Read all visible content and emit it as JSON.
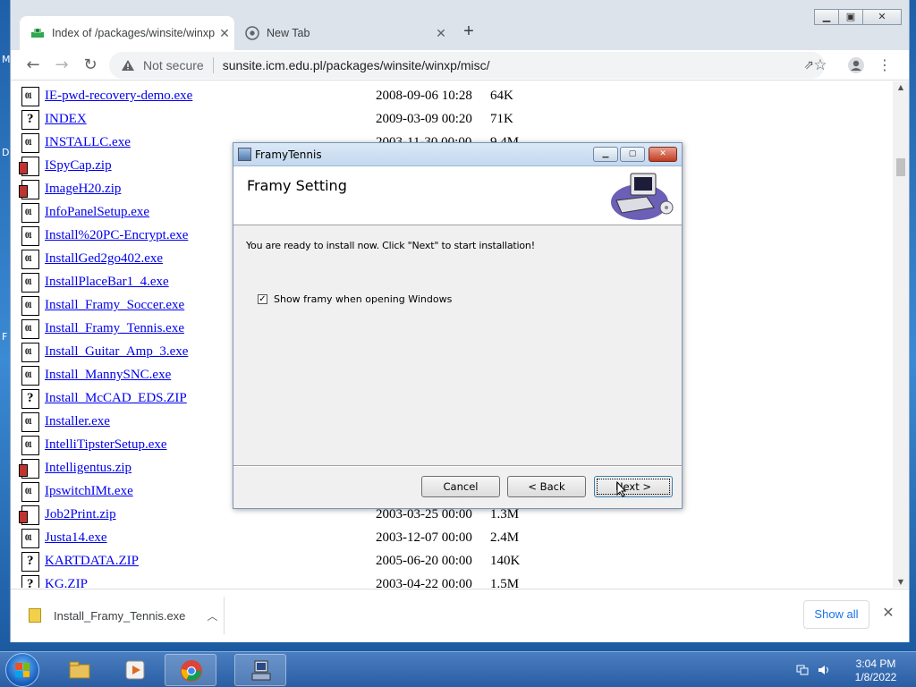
{
  "desktop": {
    "glyphs": [
      "M",
      "D",
      "F"
    ]
  },
  "browser": {
    "tabs": [
      {
        "title": "Index of /packages/winsite/winxp/misc/",
        "active": true
      },
      {
        "title": "New Tab",
        "active": false
      }
    ],
    "security_label": "Not secure",
    "url": "sunsite.icm.edu.pl/packages/winsite/winxp/misc/"
  },
  "listing": [
    {
      "name": "IE-pwd-recovery-demo.exe",
      "date": "2008-09-06 10:28",
      "size": "64K",
      "type": "exe"
    },
    {
      "name": "INDEX",
      "date": "2009-03-09 00:20",
      "size": "71K",
      "type": "unk"
    },
    {
      "name": "INSTALLC.exe",
      "date": "2003-11-30 00:00",
      "size": "9.4M",
      "type": "exe"
    },
    {
      "name": "ISpyCap.zip",
      "date": "",
      "size": "",
      "type": "zip"
    },
    {
      "name": "ImageH20.zip",
      "date": "",
      "size": "",
      "type": "zip"
    },
    {
      "name": "InfoPanelSetup.exe",
      "date": "",
      "size": "",
      "type": "exe"
    },
    {
      "name": "Install%20PC-Encrypt.exe",
      "date": "",
      "size": "",
      "type": "exe"
    },
    {
      "name": "InstallGed2go402.exe",
      "date": "",
      "size": "",
      "type": "exe"
    },
    {
      "name": "InstallPlaceBar1_4.exe",
      "date": "",
      "size": "",
      "type": "exe"
    },
    {
      "name": "Install_Framy_Soccer.exe",
      "date": "",
      "size": "",
      "type": "exe"
    },
    {
      "name": "Install_Framy_Tennis.exe",
      "date": "",
      "size": "",
      "type": "exe"
    },
    {
      "name": "Install_Guitar_Amp_3.exe",
      "date": "",
      "size": "",
      "type": "exe"
    },
    {
      "name": "Install_MannySNC.exe",
      "date": "",
      "size": "",
      "type": "exe"
    },
    {
      "name": "Install_McCAD_EDS.ZIP",
      "date": "",
      "size": "",
      "type": "unk"
    },
    {
      "name": "Installer.exe",
      "date": "",
      "size": "",
      "type": "exe"
    },
    {
      "name": "IntelliTipsterSetup.exe",
      "date": "",
      "size": "",
      "type": "exe"
    },
    {
      "name": "Intelligentus.zip",
      "date": "",
      "size": "",
      "type": "zip"
    },
    {
      "name": "IpswitchIMt.exe",
      "date": "",
      "size": "",
      "type": "exe"
    },
    {
      "name": "Job2Print.zip",
      "date": "2003-03-25 00:00",
      "size": "1.3M",
      "type": "zip"
    },
    {
      "name": "Justa14.exe",
      "date": "2003-12-07 00:00",
      "size": "2.4M",
      "type": "exe"
    },
    {
      "name": "KARTDATA.ZIP",
      "date": "2005-06-20 00:00",
      "size": "140K",
      "type": "unk"
    },
    {
      "name": "KG.ZIP",
      "date": "2003-04-22 00:00",
      "size": "1.5M",
      "type": "unk"
    }
  ],
  "download_shelf": {
    "file": "Install_Framy_Tennis.exe",
    "show_all": "Show all"
  },
  "dialog": {
    "title": "FramyTennis",
    "header": "Framy Setting",
    "message": "You are ready to install now. Click \"Next\" to start installation!",
    "checkbox_label": "Show framy when opening Windows",
    "checkbox_checked": true,
    "buttons": {
      "cancel": "Cancel",
      "back": "< Back",
      "next": "Next >"
    }
  },
  "taskbar": {
    "time": "3:04 PM",
    "date": "1/8/2022"
  }
}
